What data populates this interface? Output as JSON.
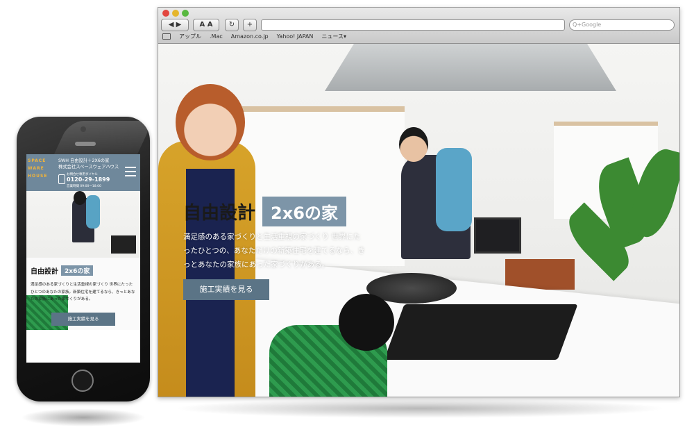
{
  "browser": {
    "search_placeholder": "Q+Google",
    "toolbar": {
      "nav_label": "◀ ▶",
      "text_size_label": "A A",
      "reload_label": "↻",
      "add_label": "+"
    },
    "bookmarks": [
      "アップル",
      ".Mac",
      "Amazon.co.jp",
      "Yahoo! JAPAN",
      "ニュース▾"
    ]
  },
  "site": {
    "hero_title_main": "自由設計",
    "hero_title_highlight": "2x6の家",
    "hero_copy": "満足感のある家づくりと生活重視の家づくり 世界にたったひとつの、あなただけの新築住宅を建てるなら、きっとあなたの家族にあった家づくりがある。",
    "cta_label": "施工実績を見る",
    "colors": {
      "accent": "#7d95a8",
      "button": "#5b7486",
      "header": "#6f889b",
      "logo": "#f1b43a"
    }
  },
  "mobile": {
    "logo_lines": [
      "SPACE",
      "WARE",
      "HOUSE"
    ],
    "brand_line1": "SWH 自由設計＋2X6の家",
    "brand_line2": "株式会社スペースウェアハウス",
    "tel_label": "お問合せ専用ダイヤル",
    "tel_number": "0120-29-1899",
    "hours": "営業時間 09:00〜18:00",
    "title_main": "自由設計",
    "title_highlight": "2x6の家",
    "copy": "満足感のある家づくりと生活重視の家づくり 世界にたったひとつのあなたの家族。新築住宅を建てるなら、きっとあなたの家族にあった家づくりがある。",
    "cta_label": "施工実績を見る"
  }
}
